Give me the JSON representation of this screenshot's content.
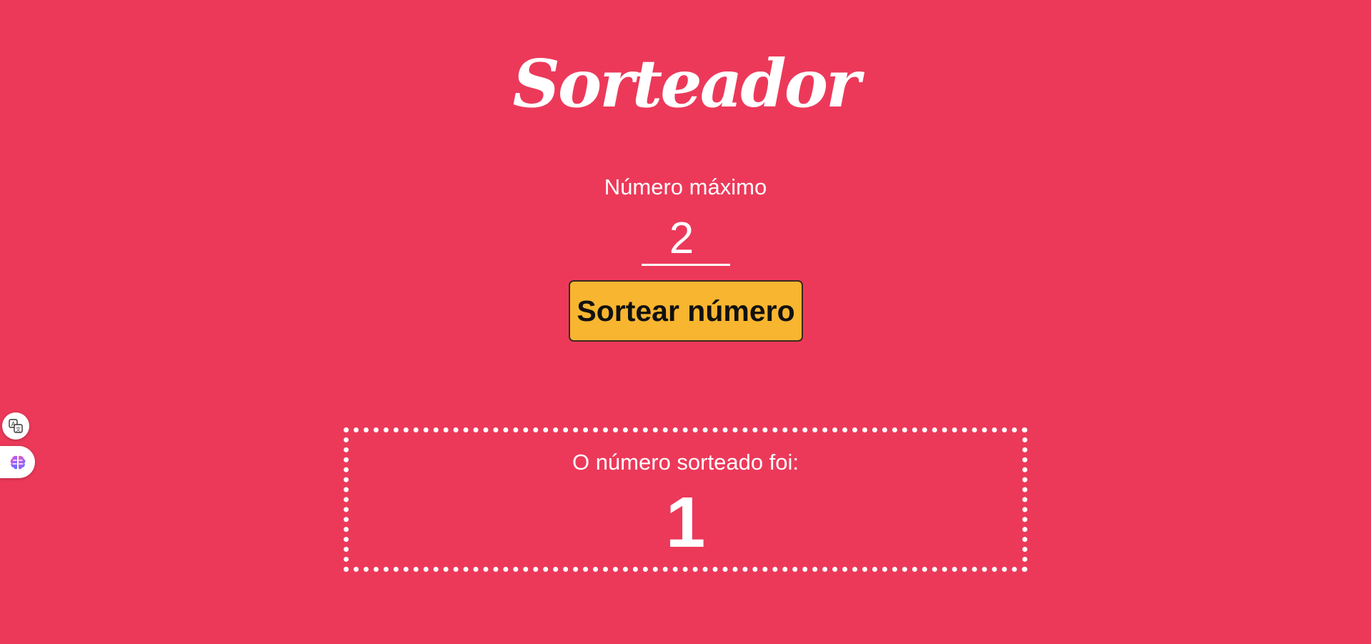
{
  "app": {
    "title": "Sorteador",
    "background_color": "#ec395a"
  },
  "form": {
    "max_label": "Número máximo",
    "max_value": "2",
    "draw_button_label": "Sortear número",
    "button_color": "#f8b530"
  },
  "result": {
    "label": "O número sorteado foi:",
    "value": "1"
  },
  "extensions": {
    "translate_icon": "translate-icon",
    "brain_icon": "brain-icon"
  }
}
